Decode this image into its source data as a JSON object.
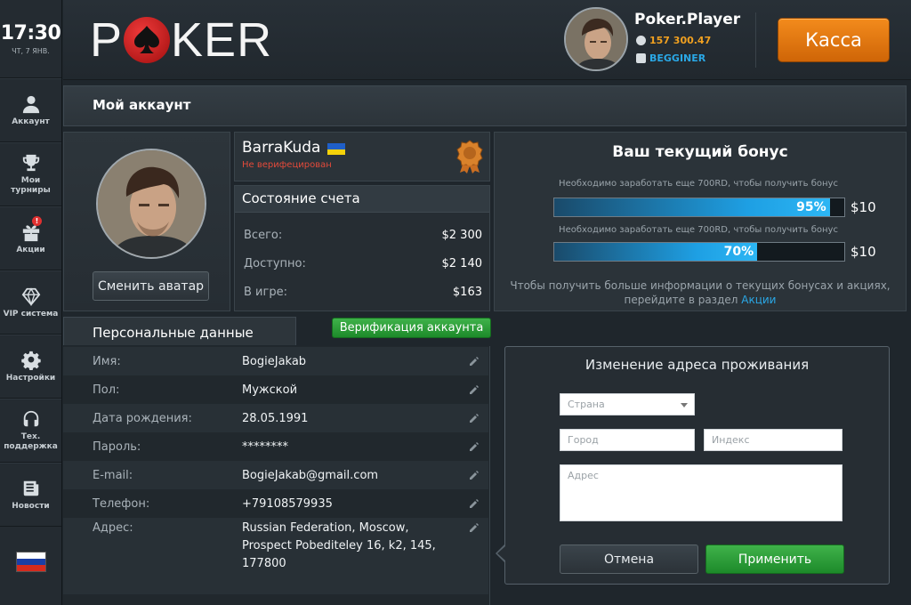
{
  "clock": {
    "time": "17:30",
    "date": "ЧТ, 7 ЯНВ."
  },
  "sidebar": {
    "items": [
      {
        "label": "Аккаунт"
      },
      {
        "label": "Мои турниры"
      },
      {
        "label": "Акции",
        "badge": "!"
      },
      {
        "label": "VIP система"
      },
      {
        "label": "Настройки"
      },
      {
        "label": "Тех. поддержка"
      },
      {
        "label": "Новости"
      }
    ],
    "language": "ru-flag-icon"
  },
  "header": {
    "logo_left": "P",
    "logo_right": "KER",
    "user": {
      "name": "Poker.Player",
      "balance": "157 300.47",
      "level": "BEGGINER"
    },
    "cashier_label": "Касса"
  },
  "page_title": "Мой аккаунт",
  "profile": {
    "change_avatar": "Сменить аватар",
    "nickname": "BarraKuda",
    "status": "Не верифецирован",
    "flag": "ua-flag-icon",
    "rank_icon": "medal-icon"
  },
  "account_state": {
    "title": "Состояние счета",
    "rows": [
      {
        "label": "Всего:",
        "value": "$2 300"
      },
      {
        "label": "Доступно:",
        "value": "$2 140"
      },
      {
        "label": "В игре:",
        "value": "$163"
      }
    ]
  },
  "bonus": {
    "title": "Ваш текущий бонус",
    "bars": [
      {
        "note": "Необходимо заработать еще 700RD, чтобы получить бонус",
        "progress": 0.95,
        "percent": "95%",
        "amount": "$10"
      },
      {
        "note": "Необходимо заработать еще 700RD, чтобы получить бонус",
        "progress": 0.7,
        "percent": "70%",
        "amount": "$10"
      }
    ],
    "info": "Чтобы получить больше информации о текущих бонусах и акциях, перейдите в раздел",
    "link": "Акции"
  },
  "personal": {
    "tab_label": "Персональные данные",
    "verify_label": "Верификация аккаунта",
    "rows": [
      {
        "label": "Имя:",
        "value": "BogieJakab"
      },
      {
        "label": "Пол:",
        "value": "Мужской"
      },
      {
        "label": "Дата рождения:",
        "value": "28.05.1991"
      },
      {
        "label": "Пароль:",
        "value": "********"
      },
      {
        "label": "E-mail:",
        "value": "BogieJakab@gmail.com"
      },
      {
        "label": "Телефон:",
        "value": "+79108579935"
      },
      {
        "label": "Адрес:",
        "value": "Russian Federation, Moscow, Prospect Pobediteley 16, k2, 145, 177800"
      }
    ]
  },
  "address_form": {
    "title": "Изменение адреса проживания",
    "country_placeholder": "Страна",
    "city_placeholder": "Город",
    "zip_placeholder": "Индекс",
    "address_placeholder": "Адрес",
    "cancel_label": "Отмена",
    "apply_label": "Применить"
  },
  "colors": {
    "accent_orange": "#f0a020",
    "link_blue": "#2aa8e6",
    "error_red": "#e34a3a",
    "green": "#2a9a36"
  }
}
